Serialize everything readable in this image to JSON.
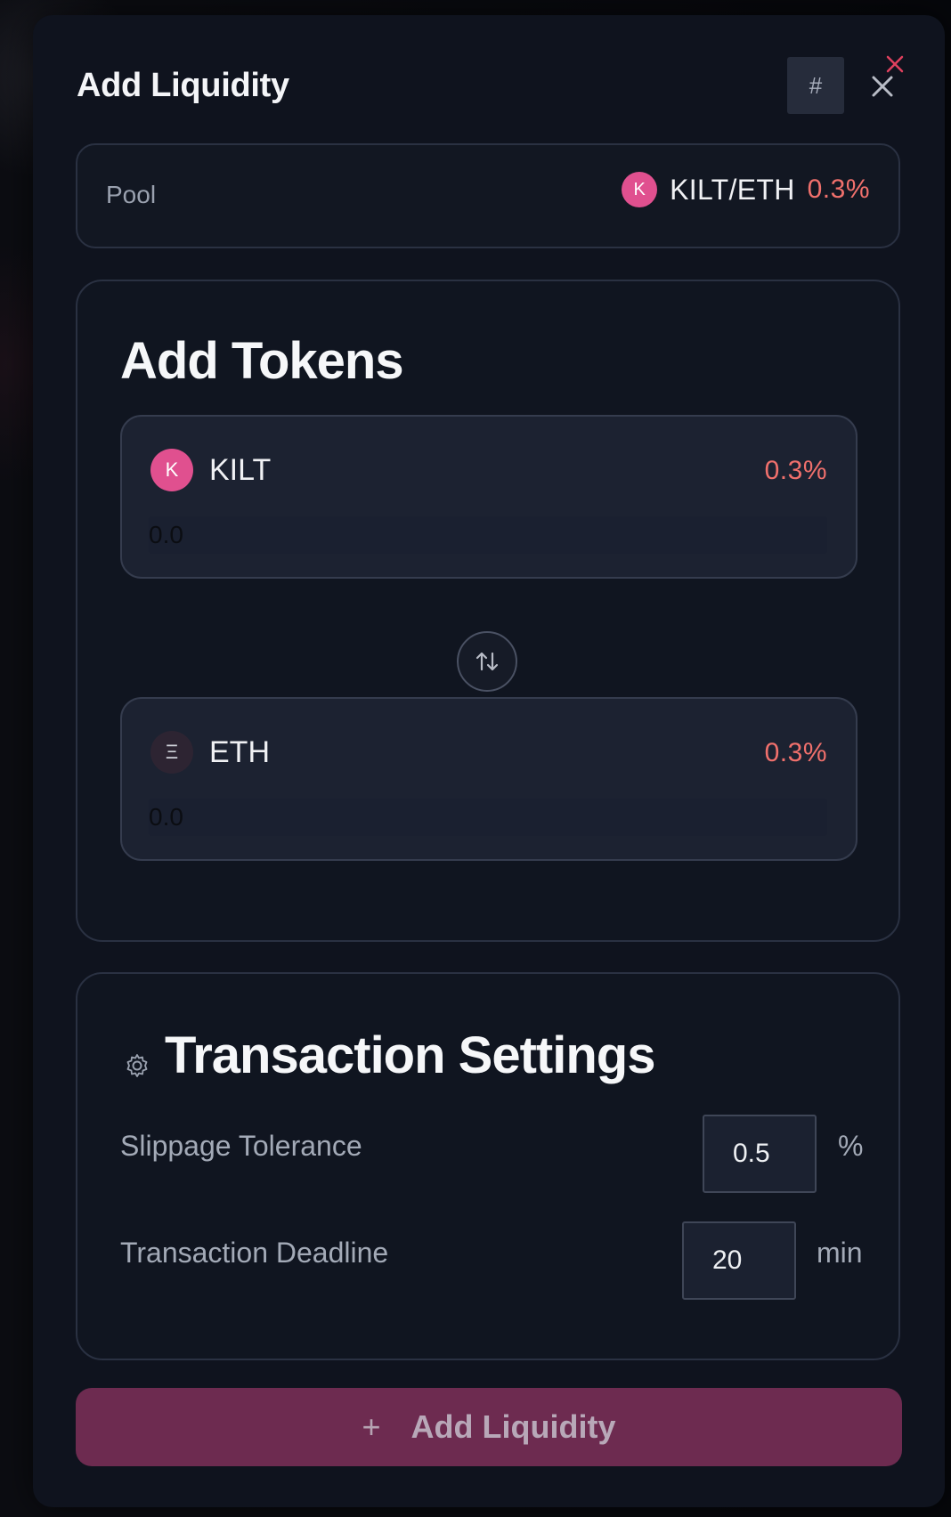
{
  "modal": {
    "title": "Add Liquidity",
    "hash_button": "#"
  },
  "pool": {
    "label": "Pool",
    "badge": "K",
    "name": "KILT/ETH",
    "fee": "0.3%"
  },
  "add_tokens": {
    "title": "Add Tokens",
    "token_a": {
      "badge": "K",
      "name": "KILT",
      "fee": "0.3%",
      "placeholder": "0.0"
    },
    "token_b": {
      "badge": "Ξ",
      "name": "ETH",
      "fee": "0.3%",
      "placeholder": "0.0"
    }
  },
  "settings": {
    "title": "Transaction Settings",
    "slippage_label": "Slippage Tolerance",
    "slippage_value": "0.5",
    "slippage_unit": "%",
    "deadline_label": "Transaction Deadline",
    "deadline_value": "20",
    "deadline_unit": "min"
  },
  "submit": {
    "icon": "+",
    "label": "Add Liquidity"
  },
  "colors": {
    "accent": "#e0508f",
    "fee": "#f0706c",
    "button_bg": "#6d2b50"
  }
}
